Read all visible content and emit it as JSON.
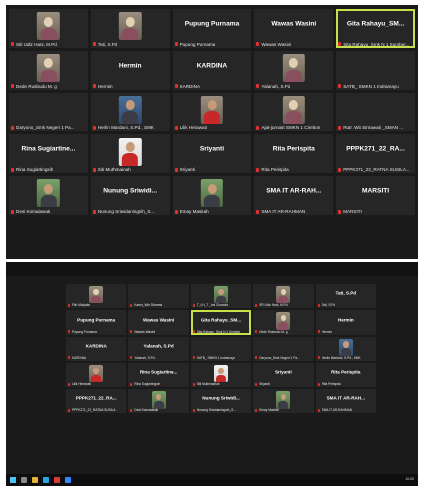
{
  "screenshot1": {
    "tiles": [
      {
        "caption": "Siti Udiz Hani, M.Pd",
        "big": "",
        "photo": "p-hijab",
        "active": false
      },
      {
        "caption": "Tati, S.Pd",
        "big": "",
        "photo": "p-hijab",
        "active": false
      },
      {
        "caption": "Pupung Purnama",
        "big": "Pupung Purnama",
        "photo": "",
        "active": false
      },
      {
        "caption": "Wawas Wasini",
        "big": "Wawas Wasini",
        "photo": "",
        "active": false
      },
      {
        "caption": "Sita Rahayu_Smk N 1 Sumber...",
        "big": "Gita Rahayu_SM...",
        "photo": "",
        "active": true
      },
      {
        "caption": "Dede Rusbudu M. g",
        "big": "",
        "photo": "p-hijab",
        "active": false
      },
      {
        "caption": "Hermin",
        "big": "Hermin",
        "photo": "",
        "active": false
      },
      {
        "caption": "KARDINA",
        "big": "KARDINA",
        "photo": "",
        "active": false
      },
      {
        "caption": "Yalanah, S.Pd",
        "big": "",
        "photo": "p-hijab",
        "active": false
      },
      {
        "caption": "SATB_ SMKN 1 Indramayu",
        "big": "",
        "photo": "",
        "active": false
      },
      {
        "caption": "Daryono_Smk Negeri 1 Pa...",
        "big": "",
        "photo": "",
        "active": false
      },
      {
        "caption": "Herlin Mardani, S.Pd., SMK",
        "big": "",
        "photo": "p-blue",
        "active": false
      },
      {
        "caption": "Lilik Herawati",
        "big": "",
        "photo": "p-red",
        "active": false
      },
      {
        "caption": "Ajat-jurnast SMKN 1 Cirebon",
        "big": "",
        "photo": "p-hijab",
        "active": false
      },
      {
        "caption": "Rutr. Wit Sirnawati _SMAN ...",
        "big": "",
        "photo": "",
        "active": false
      },
      {
        "caption": "Rina Sugiartingsih",
        "big": "Rina Sugiartine...",
        "photo": "",
        "active": false
      },
      {
        "caption": "Siti Muthmainah",
        "big": "",
        "photo": "p-white p-red",
        "active": false
      },
      {
        "caption": "Sriyanti",
        "big": "Sriyanti",
        "photo": "",
        "active": false
      },
      {
        "caption": "Rita Perispita",
        "big": "Rita Perispita",
        "photo": "",
        "active": false
      },
      {
        "caption": "PPPK271_22_RATNA SUSILA...",
        "big": "PPPK271_22_RA...",
        "photo": "",
        "active": false
      },
      {
        "caption": "Desi Komalawati",
        "big": "",
        "photo": "p-green",
        "active": false
      },
      {
        "caption": "Nunung Sriwidaningsih_S...",
        "big": "Nunung Sriwidi...",
        "photo": "",
        "active": false
      },
      {
        "caption": "Emay Masitah",
        "big": "",
        "photo": "p-green",
        "active": false
      },
      {
        "caption": "SMA IT AR-RAHMAN",
        "big": "SMA IT AR-RAH...",
        "photo": "",
        "active": false
      },
      {
        "caption": "MARSITI",
        "big": "MARSITI",
        "photo": "",
        "active": false
      }
    ]
  },
  "screenshot2": {
    "tiles": [
      {
        "caption": "Fitri Mulyatin",
        "big": "",
        "photo": "p-hijab",
        "active": false
      },
      {
        "caption": "Kamu_Win Dharma",
        "big": "",
        "photo": "",
        "active": false
      },
      {
        "caption": "T_LH_T _Imi Chandra",
        "big": "",
        "photo": "p-green",
        "active": false
      },
      {
        "caption": "SR Udiz Hani, M.Pd",
        "big": "",
        "photo": "p-hijab",
        "active": false
      },
      {
        "caption": "Tati, S.Pd",
        "big": "Tati, S.Pd",
        "photo": "",
        "active": false
      },
      {
        "caption": "Pupung Purnama",
        "big": "Pupung Purnama",
        "photo": "",
        "active": false
      },
      {
        "caption": "Wawas Wasini",
        "big": "Wawas Wasini",
        "photo": "",
        "active": false
      },
      {
        "caption": "Sita Rahayu_Smk N 1 Sumber",
        "big": "Gita Rahayu_SM...",
        "photo": "",
        "active": true
      },
      {
        "caption": "Dede Rusbudu M. g",
        "big": "",
        "photo": "p-hijab",
        "active": false
      },
      {
        "caption": "Hermin",
        "big": "Hermin",
        "photo": "",
        "active": false
      },
      {
        "caption": "KARDINA",
        "big": "KARDINA",
        "photo": "",
        "active": false
      },
      {
        "caption": "Yalanah, S.Pd",
        "big": "Yalanah, S.Pd",
        "photo": "",
        "active": false
      },
      {
        "caption": "SATB_ SMKN 1 Indramayu",
        "big": "",
        "photo": "",
        "active": false
      },
      {
        "caption": "Daryono_Smk Negeri 1 Pa...",
        "big": "",
        "photo": "",
        "active": false
      },
      {
        "caption": "Herlin Mardani, S.Pd., SMK",
        "big": "",
        "photo": "p-blue",
        "active": false
      },
      {
        "caption": "Lilik Herawati",
        "big": "",
        "photo": "p-red",
        "active": false
      },
      {
        "caption": "Rina Sugiartingsih",
        "big": "Rina Sugiartine...",
        "photo": "",
        "active": false
      },
      {
        "caption": "Siti Muthmainah",
        "big": "",
        "photo": "p-white p-red",
        "active": false
      },
      {
        "caption": "Sriyanti",
        "big": "Sriyanti",
        "photo": "",
        "active": false
      },
      {
        "caption": "Rita Perispita",
        "big": "Rita Perispita",
        "photo": "",
        "active": false
      },
      {
        "caption": "PPPK271_22_RATNA SUSILA",
        "big": "PPPK271_22_RA...",
        "photo": "",
        "active": false
      },
      {
        "caption": "Desi Komalawati",
        "big": "",
        "photo": "p-green",
        "active": false
      },
      {
        "caption": "Nunung Sriwidaningsih_S...",
        "big": "Nunung Sriwidi...",
        "photo": "",
        "active": false
      },
      {
        "caption": "Emay Masitah",
        "big": "",
        "photo": "p-green",
        "active": false
      },
      {
        "caption": "SMA IT AR-RAHMAN",
        "big": "SMA IT AR-RAH...",
        "photo": "",
        "active": false
      }
    ],
    "taskbar": {
      "clock": "10:02"
    }
  },
  "colors": {
    "active_border": "#c6e04a",
    "muted_mic": "#e0312f",
    "tile_bg": "#262626"
  }
}
